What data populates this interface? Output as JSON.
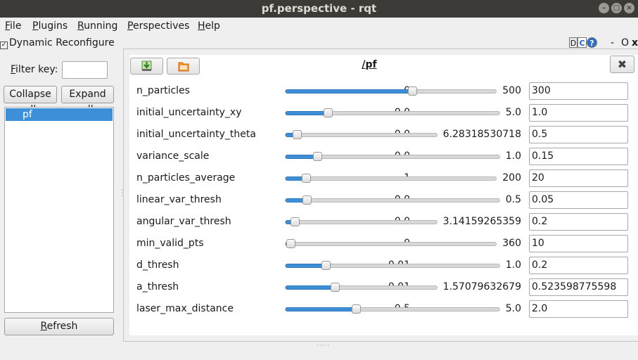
{
  "window": {
    "title": "pf.perspective - rqt",
    "btn_min": "–",
    "btn_max": "□",
    "btn_close": "×"
  },
  "menu": {
    "file_first": "F",
    "file_rest": "ile",
    "plugins_first": "P",
    "plugins_rest": "lugins",
    "running_first": "R",
    "running_rest": "unning",
    "perspectives_first": "P",
    "perspectives_rest": "erspectives",
    "help_first": "H",
    "help_rest": "elp"
  },
  "plugin": {
    "title": "Dynamic Reconfigure",
    "icon_d": "D",
    "icon_c": "C",
    "icon_help": "?",
    "minimize": "-",
    "float": "O",
    "close": "x"
  },
  "left": {
    "filter_label_first": "F",
    "filter_label_rest": "ilter key:",
    "filter_value": "",
    "collapse_label": "Collapse all",
    "expand_label": "Expand all",
    "tree_items": [
      "pf"
    ],
    "refresh_first": "R",
    "refresh_rest": "efresh"
  },
  "node": {
    "title": "/pf",
    "close": "✖"
  },
  "params": [
    {
      "name": "n_particles",
      "min": "0",
      "max": "500",
      "value": "300",
      "fraction": 0.6
    },
    {
      "name": "initial_uncertainty_xy",
      "min": "0.0",
      "max": "5.0",
      "value": "1.0",
      "fraction": 0.2
    },
    {
      "name": "initial_uncertainty_theta",
      "min": "0.0",
      "max": "6.28318530718",
      "value": "0.5",
      "fraction": 0.08
    },
    {
      "name": "variance_scale",
      "min": "0.0",
      "max": "1.0",
      "value": "0.15",
      "fraction": 0.15
    },
    {
      "name": "n_particles_average",
      "min": "1",
      "max": "200",
      "value": "20",
      "fraction": 0.1
    },
    {
      "name": "linear_var_thresh",
      "min": "0.0",
      "max": "0.5",
      "value": "0.05",
      "fraction": 0.1
    },
    {
      "name": "angular_var_thresh",
      "min": "0.0",
      "max": "3.14159265359",
      "value": "0.2",
      "fraction": 0.064
    },
    {
      "name": "min_valid_pts",
      "min": "0",
      "max": "360",
      "value": "10",
      "fraction": 0.028
    },
    {
      "name": "d_thresh",
      "min": "0.01",
      "max": "1.0",
      "value": "0.2",
      "fraction": 0.19
    },
    {
      "name": "a_thresh",
      "min": "0.01",
      "max": "1.57079632679",
      "value": "0.523598775598",
      "fraction": 0.33
    },
    {
      "name": "laser_max_distance",
      "min": "0.5",
      "max": "5.0",
      "value": "2.0",
      "fraction": 0.33
    }
  ],
  "colors": {
    "titlebar": "#3c3b37",
    "selection": "#3d8fd8",
    "slider_fill": "#3d8fd8"
  }
}
